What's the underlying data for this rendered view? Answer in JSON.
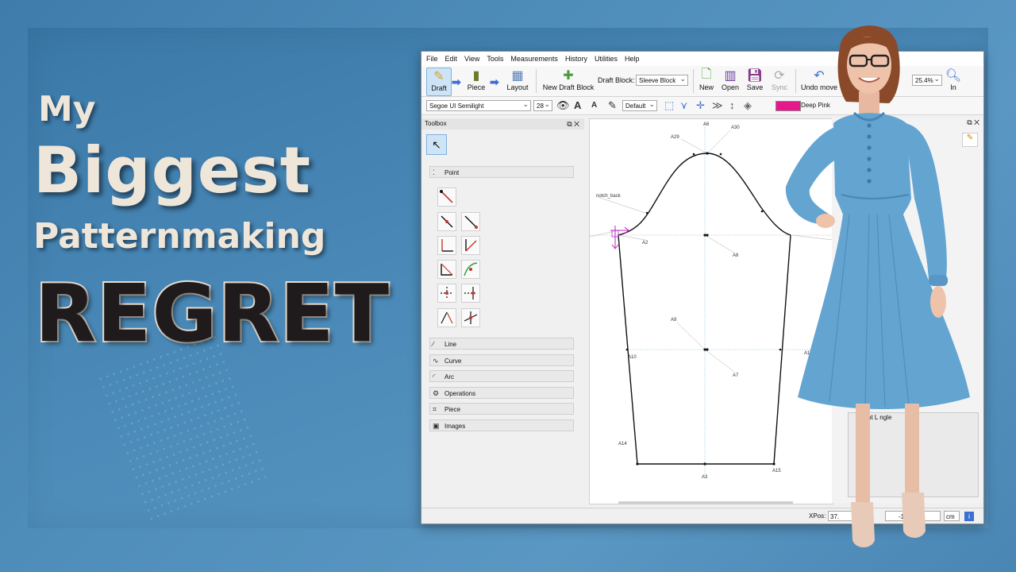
{
  "headline": {
    "line1": "My",
    "line2": "Biggest",
    "line3": "Patternmaking",
    "line4": "REGRET"
  },
  "app": {
    "menu": [
      "File",
      "Edit",
      "View",
      "Tools",
      "Measurements",
      "History",
      "Utilities",
      "Help"
    ],
    "toolbar": {
      "draft_label": "Draft",
      "piece_label": "Piece",
      "layout_label": "Layout",
      "new_draft_block_label": "New Draft Block",
      "draft_block_label": "Draft Block:",
      "draft_block_value": "Sleeve Block",
      "new_label": "New",
      "open_label": "Open",
      "save_label": "Save",
      "sync_label": "Sync",
      "undo_label": "Undo move",
      "zoom_value": "25.4%",
      "zoom_in_label": "In"
    },
    "toolbar2": {
      "font_value": "Segoe UI Semilight",
      "size_value": "28",
      "line_type_value": "Default",
      "color_value": "Deep Pink",
      "color_hex": "#e6198c"
    },
    "toolbox": {
      "title": "Toolbox",
      "groups": [
        "Point",
        "Line",
        "Curve",
        "Arc",
        "Operations",
        "Piece",
        "Images"
      ]
    },
    "canvas_labels": {
      "a6": "A6",
      "a30": "A30",
      "a29": "A29",
      "notch": "notch_back",
      "a2": "A2",
      "a8": "A8",
      "a9": "A9",
      "a10": "A10",
      "a1": "A1",
      "a7": "A7",
      "a14": "A14",
      "a15": "A15",
      "a3": "A3"
    },
    "right_panel_text": "nt L     ngle",
    "status": {
      "xpos_label": "XPos:",
      "xpos_value": "37.",
      "ypos_value": "-16.",
      "unit": "cm"
    }
  }
}
